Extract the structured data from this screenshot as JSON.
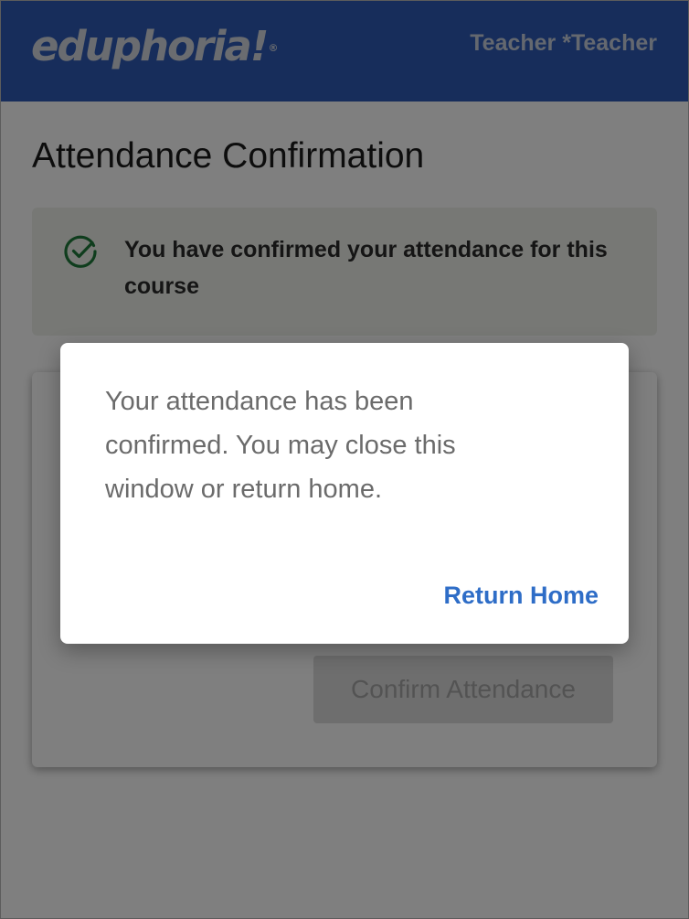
{
  "header": {
    "logo_text": "eduphoria!",
    "logo_mark": "®",
    "user_name": "Teacher *Teacher",
    "background_color": "#2f5bb6"
  },
  "page": {
    "title": "Attendance Confirmation"
  },
  "alert": {
    "icon": "check-circle-icon",
    "message": "You have confirmed your attendance for this course",
    "icon_color": "#1f7a3a"
  },
  "card": {
    "confirm_button_label": "Confirm Attendance",
    "confirm_button_state": "disabled"
  },
  "dialog": {
    "message": "Your attendance has been confirmed. You may close this window or return home.",
    "return_home_label": "Return Home",
    "link_color": "#2e6dc7"
  }
}
